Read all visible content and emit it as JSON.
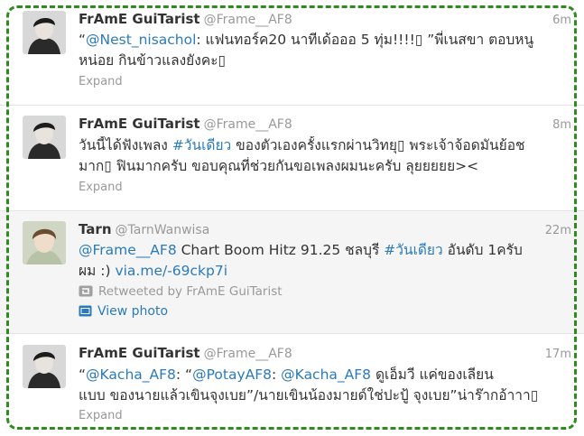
{
  "tweets": [
    {
      "name": "FrAmE GuiTarist",
      "handle": "@Frame__AF8",
      "time": "6m",
      "line1": [
        {
          "t": "“",
          "c": "text"
        },
        {
          "t": "@Nest_nisachol",
          "c": "link"
        },
        {
          "t": ": แฟนทอร์ค20 นาทีเด้อออ 5 ทุ่ม!!!!▯ ”พี่เนสขา ตอบหนู",
          "c": "text"
        }
      ],
      "line2": [
        {
          "t": "หน่อย กินข้าวแลงยังคะ▯",
          "c": "text"
        }
      ],
      "expand": "Expand"
    },
    {
      "name": "FrAmE GuiTarist",
      "handle": "@Frame__AF8",
      "time": "8m",
      "line1": [
        {
          "t": "วันนี้ได้ฟังเพลง ",
          "c": "text"
        },
        {
          "t": "#วันเดียว",
          "c": "link"
        },
        {
          "t": " ของตัวเองครั้งแรกผ่านวิทยุ▯ พระเจ้าจ้อดมันย้อช",
          "c": "text"
        }
      ],
      "line2": [
        {
          "t": "มาก▯ ฟินมากครับ ขอบคุณที่ช่วยกันขอเพลงผมนะครับ ลุยยยยย><",
          "c": "text"
        }
      ],
      "expand": "Expand"
    },
    {
      "name": "Tarn",
      "handle": "@TarnWanwisa",
      "time": "22m",
      "line1": [
        {
          "t": "@Frame__AF8",
          "c": "link"
        },
        {
          "t": " Chart Boom Hitz 91.25 ชลบุรี ",
          "c": "text"
        },
        {
          "t": "#วันเดียว",
          "c": "link"
        },
        {
          "t": " อันดับ 1ครับ",
          "c": "text"
        }
      ],
      "line2": [
        {
          "t": "ผม :) ",
          "c": "text"
        },
        {
          "t": "via.me/-69ckp7i",
          "c": "link"
        }
      ],
      "retweeted": "Retweeted by FrAmE GuiTarist",
      "view_photo": "View photo",
      "retweet_icon": "retweet-icon",
      "photo_icon": "photo-icon"
    },
    {
      "name": "FrAmE GuiTarist",
      "handle": "@Frame__AF8",
      "time": "17m",
      "line1": [
        {
          "t": "“",
          "c": "text"
        },
        {
          "t": "@Kacha_AF8",
          "c": "link"
        },
        {
          "t": ": “",
          "c": "text"
        },
        {
          "t": "@PotayAF8",
          "c": "link"
        },
        {
          "t": ": ",
          "c": "text"
        },
        {
          "t": "@Kacha_AF8",
          "c": "link"
        },
        {
          "t": " ดูเอ็มวี แค่ของเลียน",
          "c": "text"
        }
      ],
      "line2": [
        {
          "t": "แบบ ของนายแล้วเขินจุงเบย”/นายเขินน้องมายด์ใช่ปะปู้ จุงเบย”น่าร๊ากอ้าาา▯",
          "c": "text"
        }
      ],
      "expand": "Expand"
    }
  ],
  "colors": {
    "link": "#2b7bb9",
    "name": "#333333",
    "muted": "#999999",
    "frame": "#2e8b1e",
    "alt_bg": "#f5f5f5"
  }
}
